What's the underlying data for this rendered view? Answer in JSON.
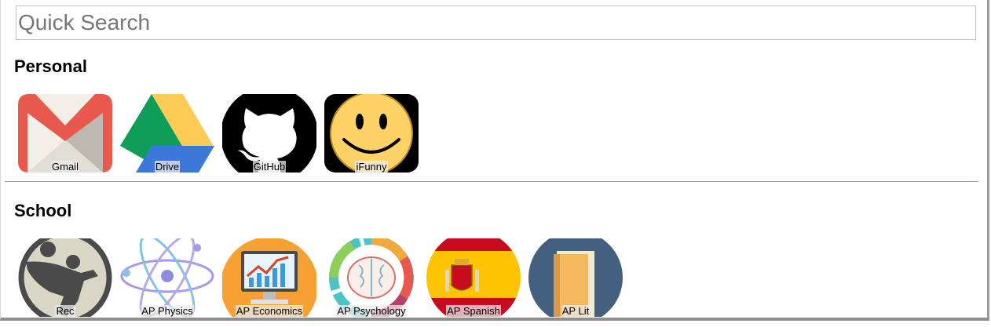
{
  "search": {
    "placeholder": "Quick Search",
    "value": ""
  },
  "sections": [
    {
      "title": "Personal",
      "links": [
        {
          "label": "Gmail",
          "icon": "gmail-icon"
        },
        {
          "label": "Drive",
          "icon": "google-drive-icon"
        },
        {
          "label": "GitHub",
          "icon": "github-octocat-icon"
        },
        {
          "label": "iFunny",
          "icon": "smiley-face-icon"
        }
      ]
    },
    {
      "title": "School",
      "links": [
        {
          "label": "Rec",
          "icon": "soccer-player-icon"
        },
        {
          "label": "AP Physics",
          "icon": "atom-icon"
        },
        {
          "label": "AP Economics",
          "icon": "growth-chart-icon"
        },
        {
          "label": "AP Psychology",
          "icon": "brain-icon"
        },
        {
          "label": "AP Spanish",
          "icon": "spain-flag-icon"
        },
        {
          "label": "AP Lit",
          "icon": "book-icon"
        }
      ]
    }
  ],
  "colors": {
    "gmail_red": "#e8584c",
    "drive_green": "#0f9d58",
    "drive_yellow": "#fbcb56",
    "drive_blue": "#3b78d8",
    "smiley_yellow": "#ffd267",
    "economics_orange": "#f7a034",
    "spain_red": "#c60b1e",
    "spain_yellow": "#ffc400",
    "book_circle": "#44607f"
  }
}
